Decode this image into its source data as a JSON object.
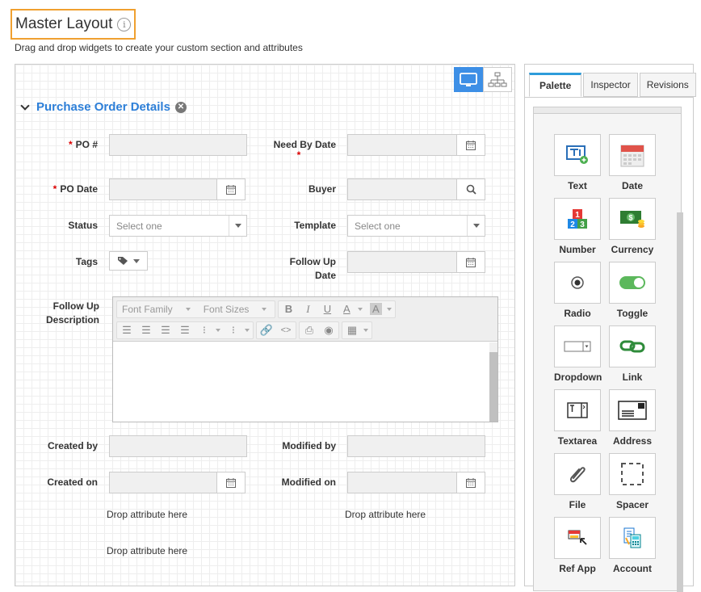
{
  "header": {
    "title": "Master Layout",
    "info_glyph": "i",
    "subtitle": "Drag and drop widgets to create your custom section and attributes"
  },
  "section": {
    "title": "Purchase Order Details"
  },
  "fields": {
    "po_number": "PO #",
    "need_by_date": "Need By Date",
    "po_date": "PO Date",
    "buyer": "Buyer",
    "status": "Status",
    "status_placeholder": "Select one",
    "template": "Template",
    "template_placeholder": "Select one",
    "tags": "Tags",
    "follow_up_date_1": "Follow Up",
    "follow_up_date_2": "Date",
    "follow_up_desc_1": "Follow Up",
    "follow_up_desc_2": "Description",
    "created_by": "Created by",
    "modified_by": "Modified by",
    "created_on": "Created on",
    "modified_on": "Modified on",
    "required_mark": "*"
  },
  "editor": {
    "font_family": "Font Family",
    "font_sizes": "Font Sizes"
  },
  "drop": {
    "left_1": "Drop attribute here",
    "right_1": "Drop attribute here",
    "left_2": "Drop attribute here"
  },
  "panel": {
    "tabs": [
      "Palette",
      "Inspector",
      "Revisions"
    ],
    "widgets": [
      "Text",
      "Date",
      "Number",
      "Currency",
      "Radio",
      "Toggle",
      "Dropdown",
      "Link",
      "Textarea",
      "Address",
      "File",
      "Spacer",
      "Ref App",
      "Account"
    ]
  },
  "colors": {
    "accent": "#2d7fd8",
    "header_border": "#f0a030",
    "active_view": "#3d8fe6",
    "required": "#dd0000"
  }
}
